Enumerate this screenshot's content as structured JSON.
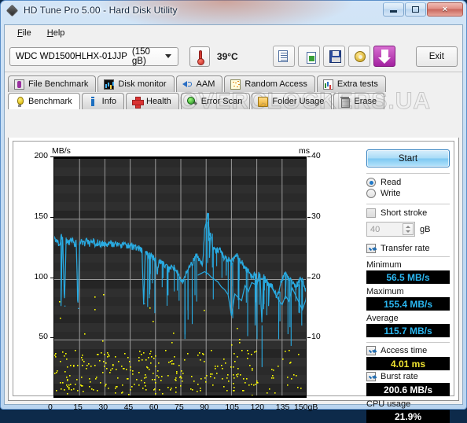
{
  "window": {
    "title": "HD Tune Pro 5.00 - Hard Disk Utility",
    "app_icon": "diamond-icon",
    "minimize": "minimize-icon",
    "maximize": "maximize-icon",
    "close": "×"
  },
  "menu": {
    "items": [
      {
        "label": "File",
        "accel": "F"
      },
      {
        "label": "Help",
        "accel": "H"
      }
    ]
  },
  "toolbar": {
    "drive": "WDC WD1500HLHX-01JJP",
    "capacity": "(150 gB)",
    "temperature": "39°C",
    "exit_label": "Exit",
    "buttons": [
      {
        "name": "copy-button",
        "icon": "copy-icon"
      },
      {
        "name": "copy-image-button",
        "icon": "copy-image-icon"
      },
      {
        "name": "save-button",
        "icon": "floppy-disk-icon"
      },
      {
        "name": "settings-button",
        "icon": "gear-icon"
      },
      {
        "name": "download-button",
        "icon": "download-arrow-icon"
      }
    ]
  },
  "tabs": {
    "row1": [
      {
        "label": "File Benchmark",
        "icon": "file-benchmark-icon",
        "active": false
      },
      {
        "label": "Disk monitor",
        "icon": "disk-monitor-icon",
        "active": false
      },
      {
        "label": "AAM",
        "icon": "speaker-icon",
        "active": false
      },
      {
        "label": "Random Access",
        "icon": "random-access-icon",
        "active": false
      },
      {
        "label": "Extra tests",
        "icon": "extra-tests-icon",
        "active": false
      }
    ],
    "row2": [
      {
        "label": "Benchmark",
        "icon": "lightbulb-icon",
        "active": true
      },
      {
        "label": "Info",
        "icon": "info-icon",
        "active": false
      },
      {
        "label": "Health",
        "icon": "red-cross-icon",
        "active": false
      },
      {
        "label": "Error Scan",
        "icon": "magnifier-icon",
        "active": false
      },
      {
        "label": "Folder Usage",
        "icon": "folder-icon",
        "active": false
      },
      {
        "label": "Erase",
        "icon": "trash-icon",
        "active": false
      }
    ]
  },
  "watermark": "OVERCLOCKERS.UA",
  "side": {
    "start_label": "Start",
    "mode": {
      "read": "Read",
      "write": "Write",
      "selected": "Read"
    },
    "short_stroke": {
      "label": "Short stroke",
      "checked": false,
      "value": "40",
      "unit": "gB"
    },
    "transfer_rate": {
      "label": "Transfer rate",
      "checked": true,
      "minimum_label": "Minimum",
      "minimum": "56.5 MB/s",
      "maximum_label": "Maximum",
      "maximum": "155.4 MB/s",
      "average_label": "Average",
      "average": "115.7 MB/s"
    },
    "access_time": {
      "label": "Access time",
      "checked": true,
      "value": "4.01 ms"
    },
    "burst_rate": {
      "label": "Burst rate",
      "checked": true,
      "value": "200.6 MB/s"
    },
    "cpu_usage": {
      "label": "CPU usage",
      "value": "21.9%"
    }
  },
  "colors": {
    "transfer_curve": "#29ABE2",
    "access_dots": "#FFFF00",
    "plot_background": "#2F2F2F",
    "value_text_cyan": "#2AB6F0",
    "value_text_yellow": "#F2E531",
    "accent_button": "#A321A0"
  },
  "chart_data": {
    "type": "line",
    "title": "",
    "xlabel": "gB",
    "ylabel": "MB/s",
    "y2label": "ms",
    "xlim": [
      0,
      150
    ],
    "ylim": [
      0,
      200
    ],
    "y2lim": [
      0,
      40
    ],
    "grid": true,
    "xticks": [
      0,
      15,
      30,
      45,
      60,
      75,
      90,
      105,
      120,
      135,
      150
    ],
    "xticklabels": [
      "0",
      "15",
      "30",
      "45",
      "60",
      "75",
      "90",
      "105",
      "120",
      "135",
      "150gB"
    ],
    "yticks": [
      50,
      100,
      150,
      200
    ],
    "yticklabels": [
      "50",
      "100",
      "150",
      "200"
    ],
    "y2ticks": [
      10,
      20,
      30,
      40
    ],
    "y2ticklabels": [
      "10",
      "20",
      "30",
      "40"
    ],
    "legend": "none",
    "series": [
      {
        "name": "Transfer rate",
        "axis": "left",
        "color": "#29ABE2",
        "unit": "MB/s",
        "x": [
          0,
          1,
          2,
          3,
          4,
          5,
          6,
          7,
          8,
          9,
          10,
          11,
          12,
          13,
          14,
          15,
          16,
          17,
          18,
          19,
          20,
          21,
          22,
          23,
          24,
          25,
          26,
          27,
          28,
          29,
          30,
          31,
          32,
          33,
          34,
          35,
          36,
          37,
          38,
          39,
          40,
          41,
          42,
          43,
          44,
          45,
          46,
          47,
          48,
          49,
          50,
          51,
          52,
          53,
          54,
          55,
          56,
          57,
          58,
          59,
          60,
          61,
          62,
          63,
          64,
          65,
          66,
          67,
          68,
          69,
          70,
          71,
          72,
          73,
          74,
          75,
          76,
          77,
          78,
          79,
          80,
          81,
          82,
          83,
          84,
          85,
          86,
          87,
          88,
          89,
          90,
          91,
          92,
          93,
          94,
          95,
          96,
          97,
          98,
          99,
          100,
          101,
          102,
          103,
          104,
          105,
          106,
          107,
          108,
          109,
          110,
          111,
          112,
          113,
          114,
          115,
          116,
          117,
          118,
          119,
          120,
          121,
          122,
          123,
          124,
          125,
          126,
          127,
          128,
          129,
          130,
          131,
          132,
          133,
          134,
          135,
          136,
          137,
          138,
          139,
          140,
          141,
          142,
          143,
          144,
          145,
          146,
          147,
          148,
          149,
          150
        ],
        "y": [
          134,
          133,
          131,
          128,
          135,
          136,
          78,
          132,
          133,
          130,
          132,
          133,
          128,
          131,
          76,
          130,
          132,
          131,
          130,
          132,
          131,
          129,
          130,
          132,
          130,
          129,
          131,
          130,
          129,
          130,
          130,
          130,
          129,
          130,
          129,
          129,
          129,
          130,
          129,
          129,
          128,
          129,
          128,
          128,
          128,
          128,
          127,
          127,
          127,
          126,
          126,
          125,
          124,
          80,
          124,
          122,
          120,
          120,
          119,
          118,
          117,
          105,
          116,
          115,
          114,
          113,
          112,
          110,
          108,
          110,
          112,
          110,
          108,
          105,
          102,
          100,
          98,
          100,
          105,
          108,
          110,
          112,
          114,
          118,
          120,
          118,
          116,
          114,
          112,
          140,
          148,
          155,
          135,
          138,
          126,
          124,
          123,
          125,
          124,
          122,
          120,
          118,
          117,
          116,
          115,
          114,
          116,
          118,
          120,
          118,
          116,
          114,
          112,
          110,
          108,
          106,
          104,
          102,
          103,
          105,
          95,
          104,
          103,
          62,
          102,
          100,
          98,
          96,
          95,
          94,
          92,
          88,
          86,
          90,
          98,
          100,
          102,
          104,
          103,
          101,
          99,
          97,
          95,
          93,
          96,
          98,
          100,
          99,
          96,
          92,
          88
        ]
      },
      {
        "name": "Access time",
        "axis": "right",
        "color": "#29ABE2",
        "unit": "ms",
        "x": [
          85,
          87,
          89,
          91,
          93,
          95,
          97,
          99,
          101,
          103,
          105,
          107,
          109,
          111,
          113,
          115,
          117,
          119,
          121,
          123,
          125,
          127,
          129,
          131,
          133,
          135,
          137,
          139,
          141,
          143,
          145,
          147,
          149,
          150
        ],
        "y": [
          20.7,
          21.0,
          21.3,
          21.0,
          20.4,
          20.0,
          19.6,
          18.8,
          18.3,
          17.5,
          14.0,
          17.6,
          17.0,
          16.5,
          19.0,
          18.0,
          19.5,
          19.2,
          19.8,
          20.2,
          20.0,
          19.4,
          18.6,
          17.6,
          16.6,
          15.8,
          17.3,
          16.4,
          18.6,
          17.4,
          16.2,
          15.0,
          16.6,
          18.4
        ]
      },
      {
        "name": "Access time samples",
        "axis": "left",
        "color": "#FFFF00",
        "type": "scatter",
        "note": "yellow dot cloud of per-sample access times, mostly in 0-50 band"
      }
    ]
  }
}
